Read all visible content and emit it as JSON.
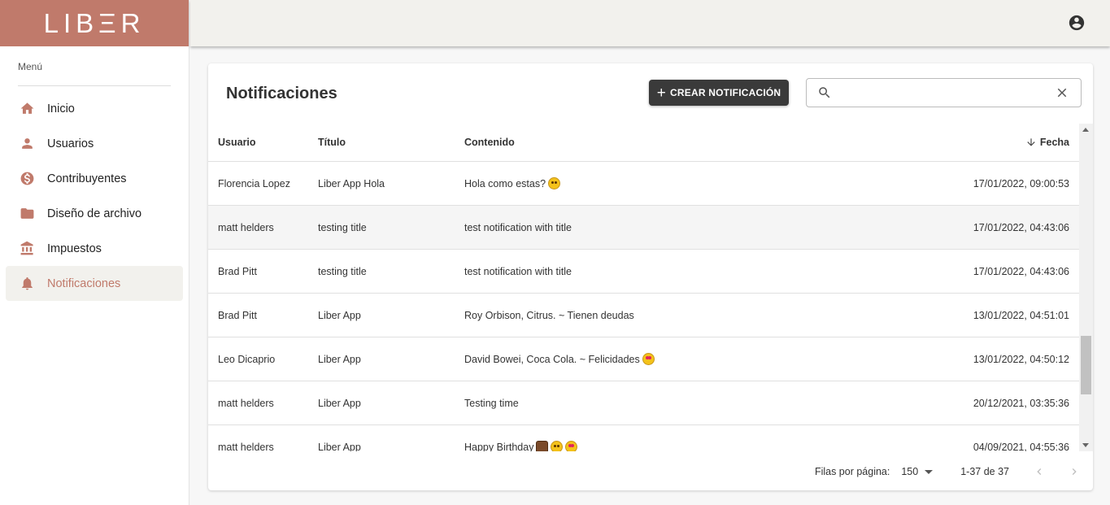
{
  "app": {
    "logo": "LIBΞR"
  },
  "sidebar": {
    "menu_label": "Menú",
    "items": [
      {
        "label": "Inicio",
        "icon": "home-icon"
      },
      {
        "label": "Usuarios",
        "icon": "person-icon"
      },
      {
        "label": "Contribuyentes",
        "icon": "dollar-icon"
      },
      {
        "label": "Diseño de archivo",
        "icon": "folder-icon"
      },
      {
        "label": "Impuestos",
        "icon": "bank-icon"
      },
      {
        "label": "Notificaciones",
        "icon": "bell-icon",
        "active": true
      }
    ]
  },
  "header": {
    "account_icon": "account-circle-icon"
  },
  "main": {
    "title": "Notificaciones",
    "create_button": "CREAR NOTIFICACIÓN",
    "search": {
      "value": "",
      "placeholder": ""
    },
    "table": {
      "columns": [
        "Usuario",
        "Título",
        "Contenido",
        "Fecha"
      ],
      "sorted_column": "Fecha",
      "rows": [
        {
          "usuario": "Florencia Lopez",
          "titulo": "Liber App Hola",
          "contenido": "Hola como estas?",
          "emojis": [
            "face"
          ],
          "fecha": "17/01/2022, 09:00:53"
        },
        {
          "usuario": "matt helders",
          "titulo": "testing title",
          "contenido": "test notification with title",
          "emojis": [],
          "fecha": "17/01/2022, 04:43:06"
        },
        {
          "usuario": "Brad Pitt",
          "titulo": "testing title",
          "contenido": "test notification with title",
          "emojis": [],
          "fecha": "17/01/2022, 04:43:06"
        },
        {
          "usuario": "Brad Pitt",
          "titulo": "Liber App",
          "contenido": "Roy Orbison, Citrus. ~ Tienen deudas",
          "emojis": [],
          "fecha": "13/01/2022, 04:51:01"
        },
        {
          "usuario": "Leo Dicaprio",
          "titulo": "Liber App",
          "contenido": "David Bowei, Coca Cola. ~ Felicidades",
          "emojis": [
            "love"
          ],
          "fecha": "13/01/2022, 04:50:12"
        },
        {
          "usuario": "matt helders",
          "titulo": "Liber App",
          "contenido": "Testing time",
          "emojis": [],
          "fecha": "20/12/2021, 03:35:36"
        },
        {
          "usuario": "matt helders",
          "titulo": "Liber App",
          "contenido": "Happy Birthday",
          "emojis": [
            "cake",
            "face",
            "love"
          ],
          "fecha": "04/09/2021, 04:55:36"
        }
      ]
    },
    "footer": {
      "rows_per_page_label": "Filas por página:",
      "rows_per_page_value": "150",
      "range": "1-37 de 37"
    }
  },
  "colors": {
    "brand": "#c07a6b",
    "topbar": "#f2f1ed",
    "button": "#3a3a3a"
  }
}
